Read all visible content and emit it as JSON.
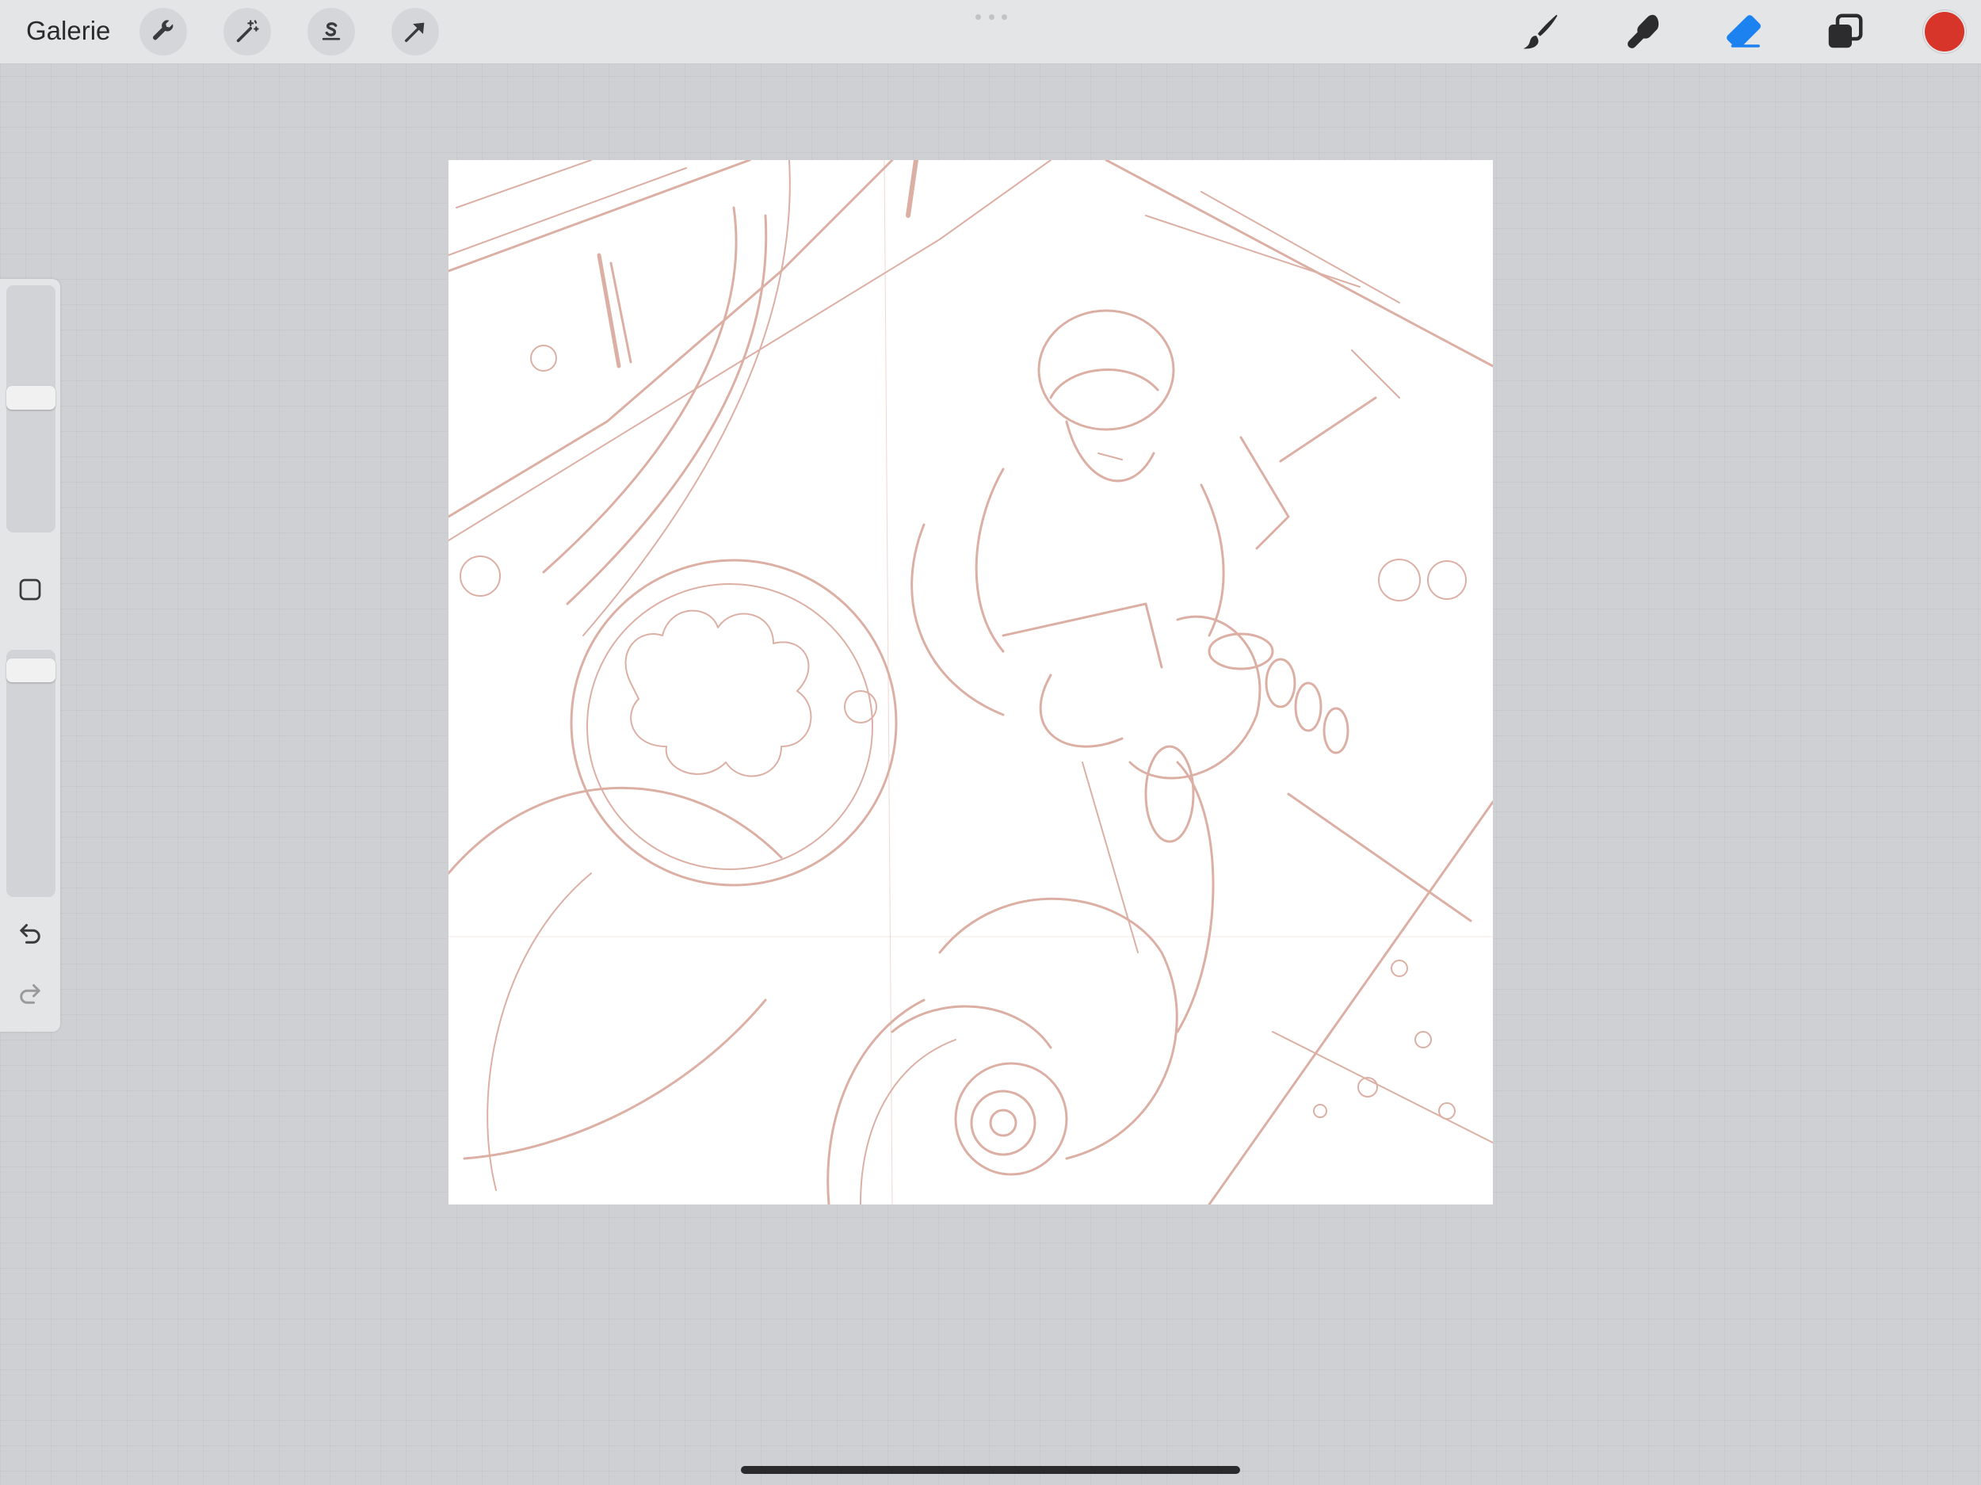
{
  "topbar": {
    "gallery_label": "Galerie",
    "left_tools": [
      {
        "name": "actions",
        "icon": "wrench-icon"
      },
      {
        "name": "adjustments",
        "icon": "magic-wand-icon"
      },
      {
        "name": "selection",
        "icon": "selection-s-icon"
      },
      {
        "name": "transform",
        "icon": "arrow-cursor-icon"
      }
    ],
    "right_tools": [
      {
        "name": "brush",
        "icon": "brush-icon",
        "active": false
      },
      {
        "name": "smudge",
        "icon": "smudge-finger-icon",
        "active": false
      },
      {
        "name": "eraser",
        "icon": "eraser-icon",
        "active": true
      },
      {
        "name": "layers",
        "icon": "layers-icon",
        "active": false
      }
    ],
    "current_color": "#d8352a",
    "active_tool_color": "#1b82f0"
  },
  "sidebar": {
    "brush_size_level": 0.55,
    "opacity_level": 0.96,
    "modify_button_icon": "square-outline-icon",
    "undo_icon": "undo-icon",
    "redo_icon": "redo-icon"
  },
  "canvas": {
    "background": "#ffffff",
    "sketch_stroke_color": "#d9a79b",
    "content": "sketch"
  }
}
